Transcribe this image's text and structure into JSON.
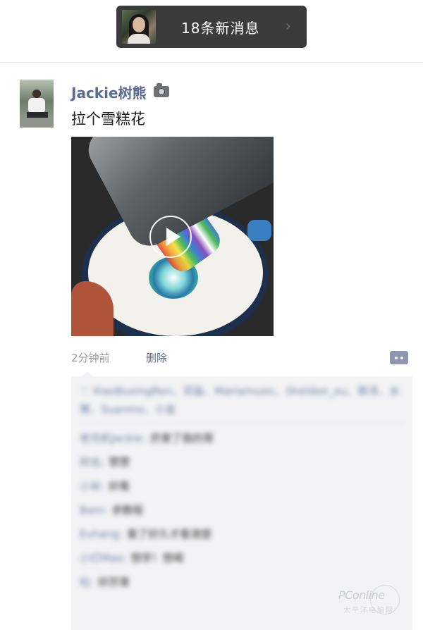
{
  "banner": {
    "text": "18条新消息",
    "chevron": "›"
  },
  "post": {
    "username": "Jackie树熊",
    "text": "拉个雪糕花",
    "time": "2分钟前",
    "delete_label": "删除"
  },
  "icons": {
    "banner_avatar": "user-avatar",
    "post_avatar": "user-avatar",
    "camera": "camera-icon",
    "play": "play-icon",
    "comment": "comment-bubble-icon"
  },
  "colors": {
    "banner_bg": "#3b3b3b",
    "link_blue": "#5b6b92",
    "comment_area_bg": "#f3f3f5"
  },
  "comments": {
    "likes_line": "♡ XiaoBuxingRen、邓淼、Mariamusic、Sheldon_xu、郭洋、水寒、Suanmo、小金",
    "items": [
      {
        "name": "老司机Jackie",
        "text": "厉害了我的哥"
      },
      {
        "name": "阿毛",
        "text": "赞赞"
      },
      {
        "name": "小米",
        "text": "好看"
      },
      {
        "name": "Bam",
        "text": "求教程"
      },
      {
        "name": "Evhang",
        "text": "看了好久才看清楚"
      },
      {
        "name": "小灯Mao",
        "text": "想学！想喝"
      },
      {
        "name": "杜",
        "text": "好厉害"
      }
    ]
  },
  "watermark": {
    "brand": "PConline",
    "sub": "太平洋电脑网"
  }
}
